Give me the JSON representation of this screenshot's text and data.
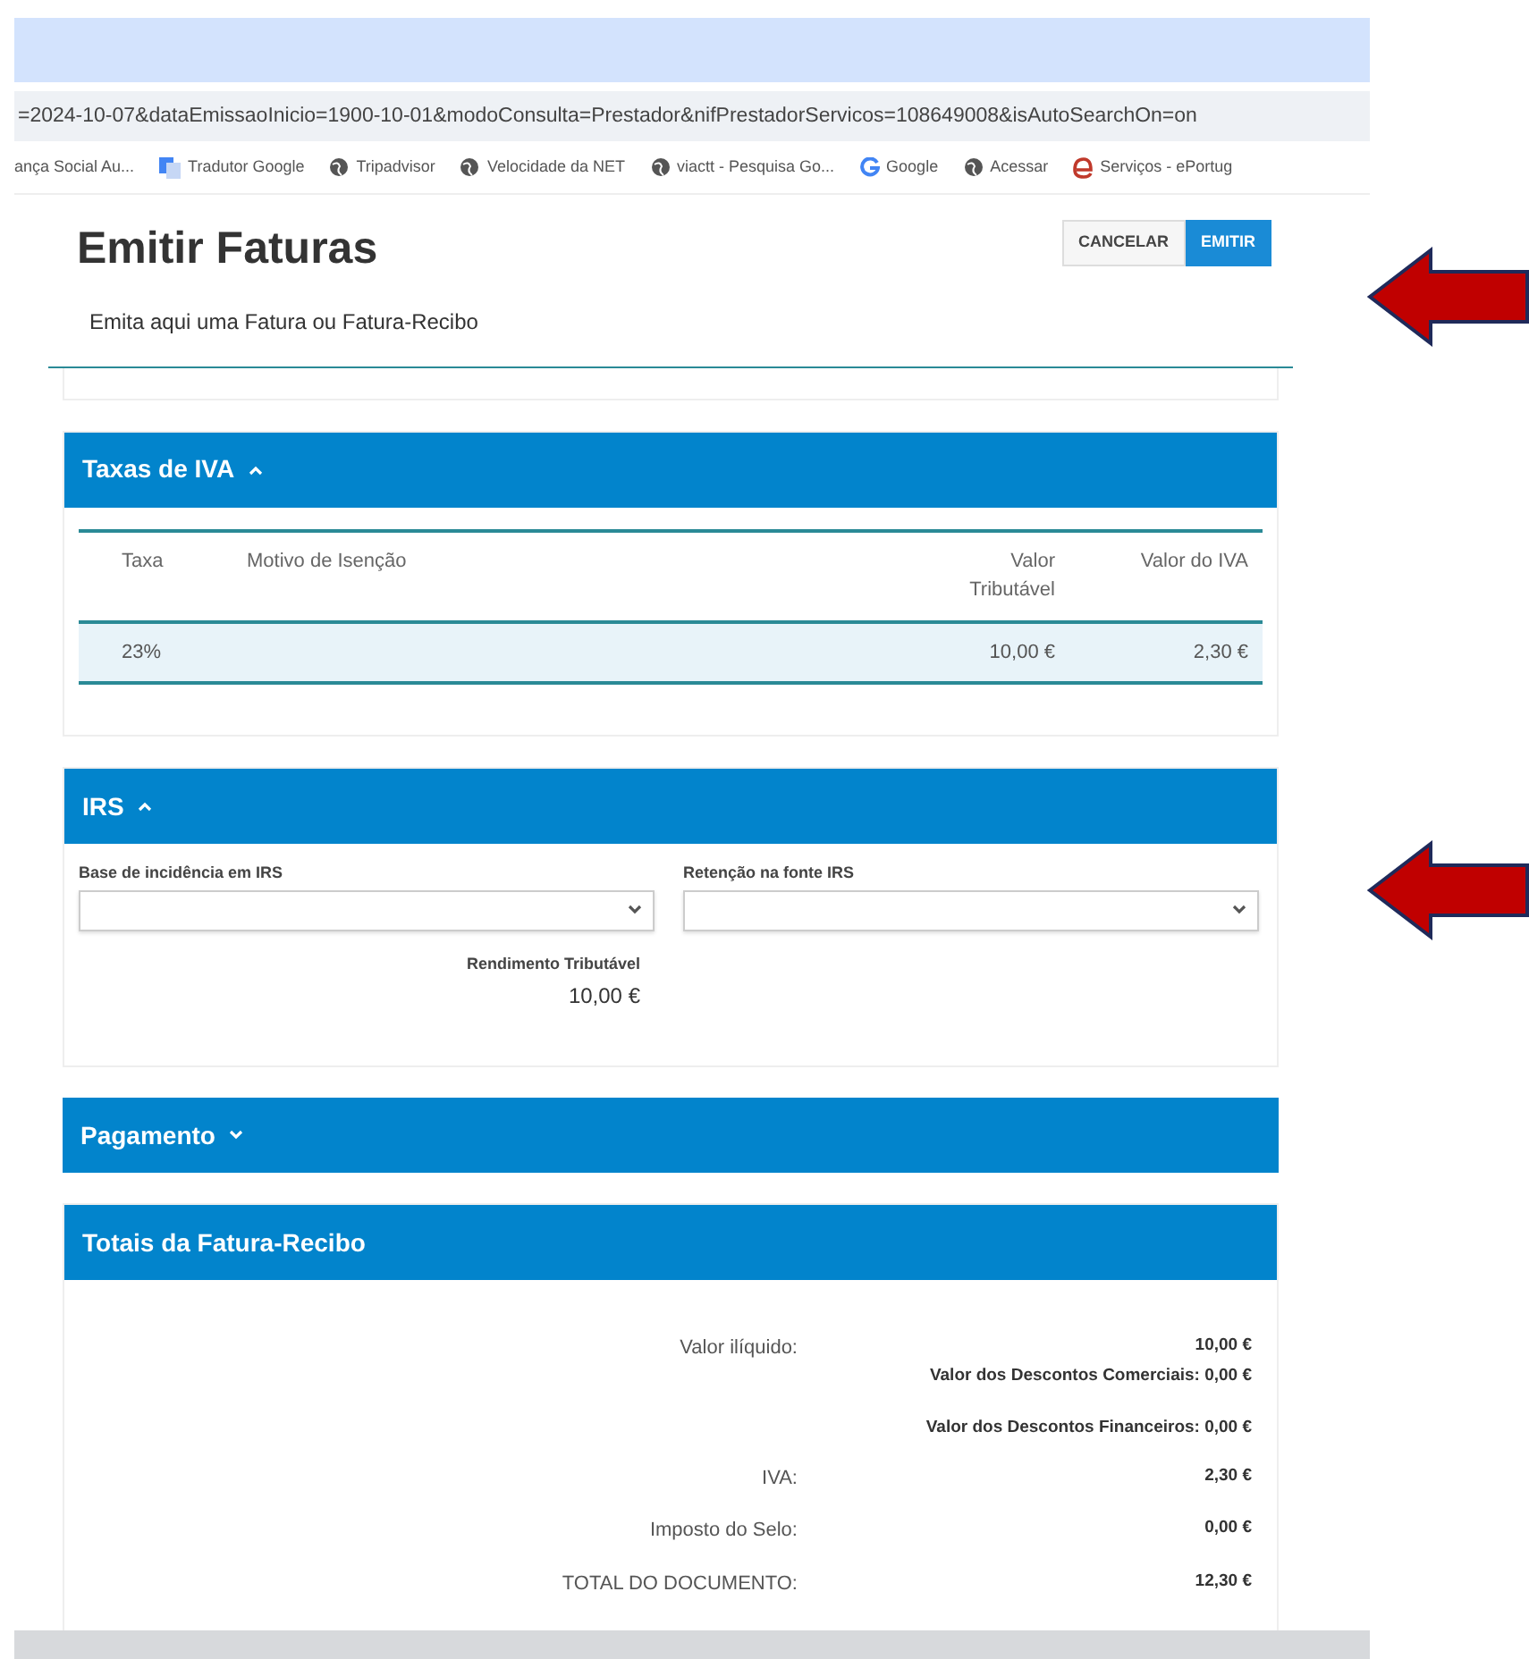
{
  "browser": {
    "address": "=2024-10-07&dataEmissaoInicio=1900-10-01&modoConsulta=Prestador&nifPrestadorServicos=108649008&isAutoSearchOn=on",
    "bookmarks": [
      {
        "label": "ança Social Au...",
        "kind": "none"
      },
      {
        "label": "Tradutor Google",
        "kind": "translate"
      },
      {
        "label": "Tripadvisor",
        "kind": "globe"
      },
      {
        "label": "Velocidade da NET",
        "kind": "globe"
      },
      {
        "label": "viactt - Pesquisa Go...",
        "kind": "globe"
      },
      {
        "label": "Google",
        "kind": "google"
      },
      {
        "label": "Acessar",
        "kind": "globe"
      },
      {
        "label": "Serviços - ePortug",
        "kind": "edge"
      }
    ]
  },
  "page": {
    "title": "Emitir Faturas",
    "subtitle": "Emita aqui uma Fatura ou Fatura-Recibo",
    "buttons": [
      {
        "label": "CANCELAR",
        "kind": "secondary"
      },
      {
        "label": "EMITIR",
        "kind": "primary"
      }
    ]
  },
  "sections": [
    {
      "kind": "table",
      "title": "Taxas de IVA",
      "expanded": true,
      "columns": [
        "Taxa",
        "Motivo de Isenção",
        "Valor Tributável",
        "Valor do IVA"
      ],
      "rows": [
        [
          "23%",
          "",
          "10,00 €",
          "2,30 €"
        ]
      ]
    },
    {
      "kind": "irs",
      "title": "IRS",
      "expanded": true,
      "fields": [
        {
          "label": "Base de incidência em IRS"
        },
        {
          "label": "Retenção na fonte IRS"
        }
      ],
      "income_label": "Rendimento Tributável",
      "income_value": "10,00 €"
    },
    {
      "kind": "collapsed",
      "title": "Pagamento",
      "expanded": false
    },
    {
      "kind": "totals",
      "title": "Totais da Fatura-Recibo",
      "rows": [
        {
          "label": "Valor ilíquido:",
          "value": "10,00 €",
          "notes": [
            "Valor dos Descontos Comerciais: 0,00 €",
            "Valor dos Descontos Financeiros: 0,00 €"
          ]
        },
        {
          "label": "IVA:",
          "value": "2,30 €"
        },
        {
          "label": "Imposto do Selo:",
          "value": "0,00 €"
        },
        {
          "label": "TOTAL DO DOCUMENTO:",
          "value": "12,30 €"
        }
      ]
    }
  ],
  "annotations": [
    {
      "kind": "arrow"
    },
    {
      "kind": "arrow"
    }
  ]
}
